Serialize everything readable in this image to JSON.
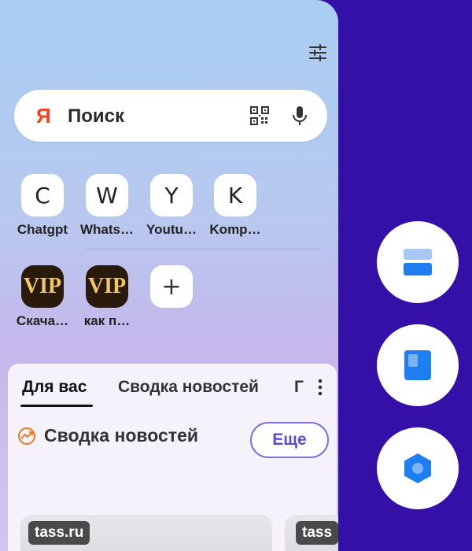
{
  "search": {
    "logo": "Я",
    "placeholder": "Поиск"
  },
  "shortcuts": [
    {
      "glyph": "C",
      "label": "Chatgpt"
    },
    {
      "glyph": "W",
      "label": "Whats…"
    },
    {
      "glyph": "Y",
      "label": "Youtu…"
    },
    {
      "glyph": "K",
      "label": "Komp…"
    },
    {
      "glyph": "VIP",
      "label": "Скача…"
    },
    {
      "glyph": "VIP",
      "label": "как п…"
    },
    {
      "glyph": "+",
      "label": ""
    }
  ],
  "feed": {
    "tabs": [
      "Для вас",
      "Сводка новостей",
      "Г"
    ],
    "section_title": "Сводка новостей",
    "more_button": "Еще",
    "cards": [
      {
        "source": "tass.ru"
      },
      {
        "source": "tass"
      }
    ]
  },
  "colors": {
    "background": "#3410a8",
    "accent": "#5a49d6",
    "yandex_red": "#fc3f1d",
    "fab_blue": "#1f7ef0"
  },
  "side_actions": [
    {
      "icon": "split-screen-icon"
    },
    {
      "icon": "page-icon"
    },
    {
      "icon": "hexagon-icon"
    }
  ]
}
